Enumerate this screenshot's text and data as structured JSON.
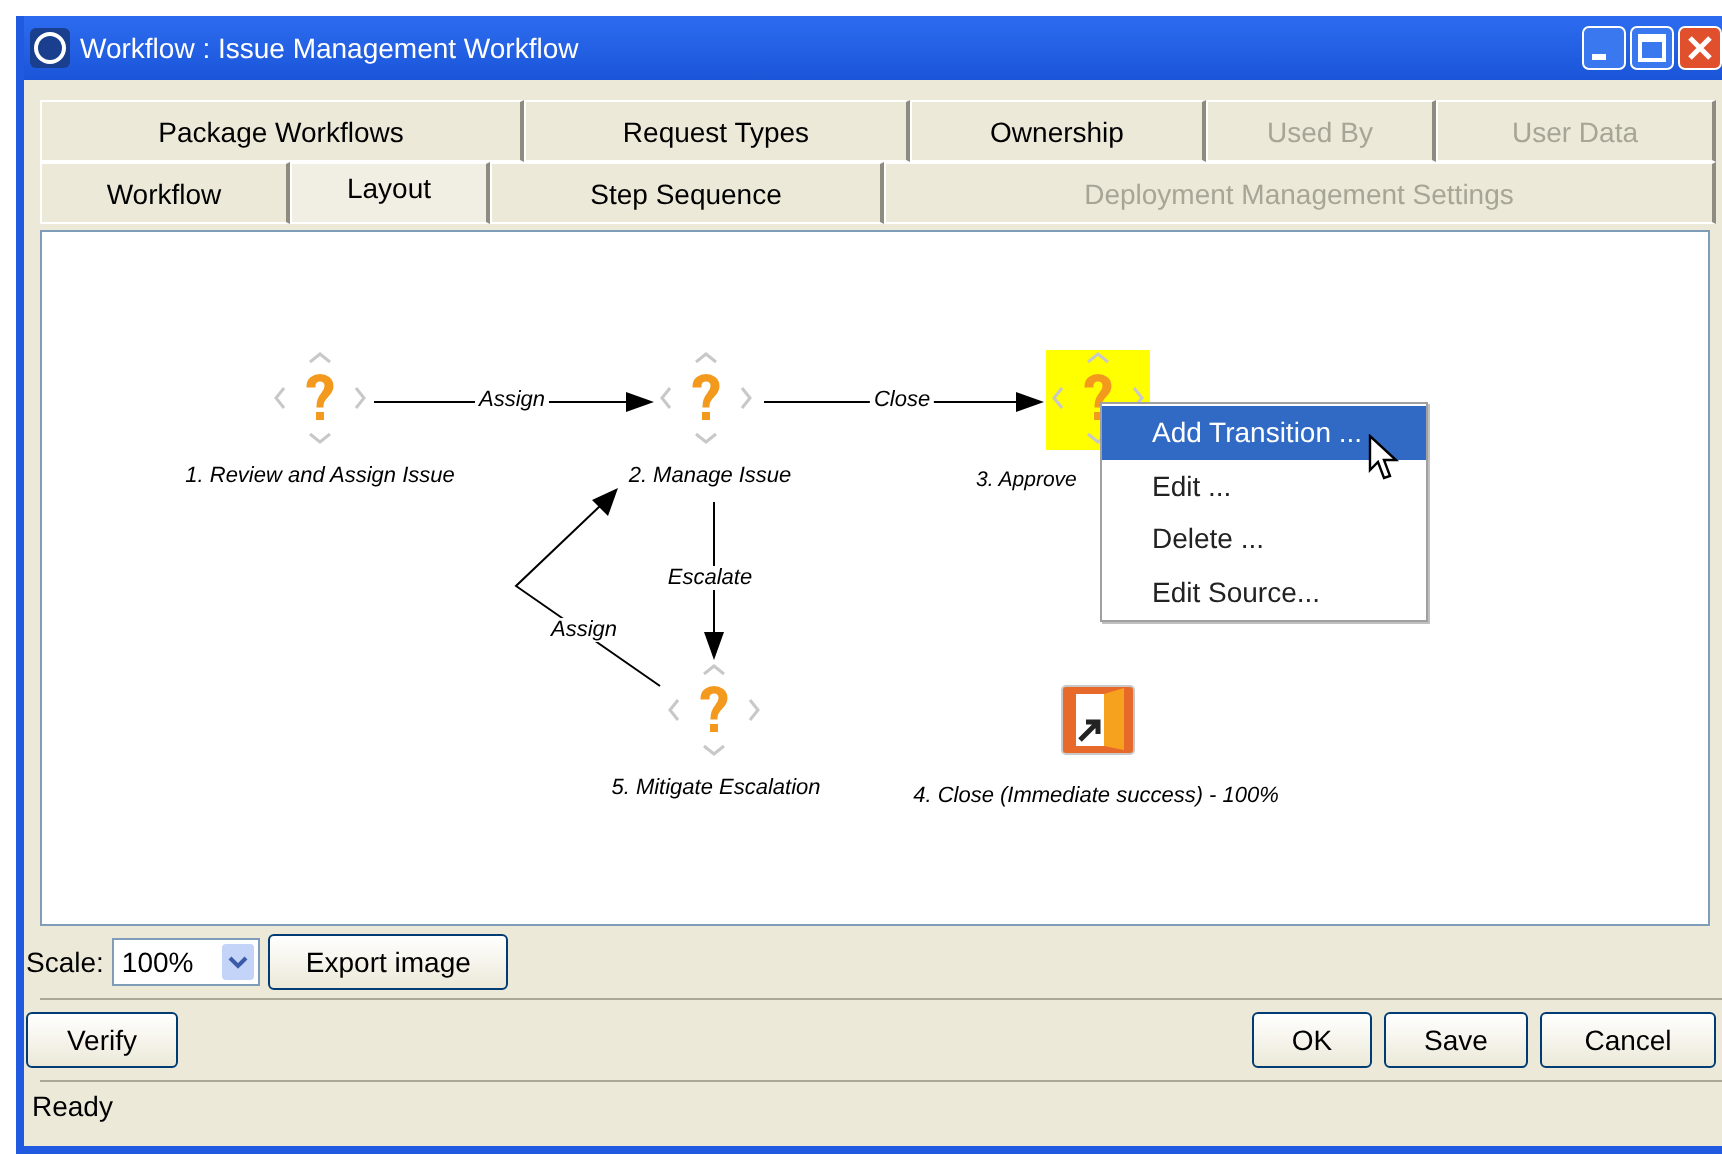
{
  "window": {
    "title": "Workflow : Issue Management Workflow"
  },
  "tab_rows": [
    [
      {
        "label": "Package Workflows",
        "selected": false,
        "disabled": false
      },
      {
        "label": "Request Types",
        "selected": false,
        "disabled": false
      },
      {
        "label": "Ownership",
        "selected": false,
        "disabled": false
      },
      {
        "label": "Used By",
        "selected": false,
        "disabled": true
      },
      {
        "label": "User Data",
        "selected": false,
        "disabled": true
      }
    ],
    [
      {
        "label": "Workflow",
        "selected": false,
        "disabled": false
      },
      {
        "label": "Layout",
        "selected": true,
        "disabled": false
      },
      {
        "label": "Step Sequence",
        "selected": false,
        "disabled": false
      },
      {
        "label": "Deployment Management Settings",
        "selected": false,
        "disabled": true
      }
    ]
  ],
  "diagram": {
    "steps": [
      {
        "label": "1. Review and Assign Issue",
        "kind": "decision",
        "highlighted": false
      },
      {
        "label": "2. Manage Issue",
        "kind": "decision",
        "highlighted": false
      },
      {
        "label": "3. Approve",
        "kind": "decision",
        "highlighted": true
      },
      {
        "label": "5. Mitigate Escalation",
        "kind": "decision",
        "highlighted": false
      },
      {
        "label": "4. Close (Immediate success) - 100%",
        "kind": "close",
        "highlighted": false
      }
    ],
    "transitions": [
      {
        "label": "Assign"
      },
      {
        "label": "Close"
      },
      {
        "label": "Escalate"
      },
      {
        "label": "Assign"
      }
    ],
    "context_menu": [
      {
        "label": "Add Transition ...",
        "selected": true
      },
      {
        "label": "Edit ...",
        "selected": false
      },
      {
        "label": "Delete ...",
        "selected": false
      },
      {
        "label": "Edit Source...",
        "selected": false
      }
    ]
  },
  "scale": {
    "label": "Scale:",
    "value": "100%"
  },
  "export_button": "Export image",
  "left_buttons": [
    "Verify"
  ],
  "right_buttons": [
    "OK",
    "Save",
    "Cancel"
  ],
  "status_bar": "Ready"
}
